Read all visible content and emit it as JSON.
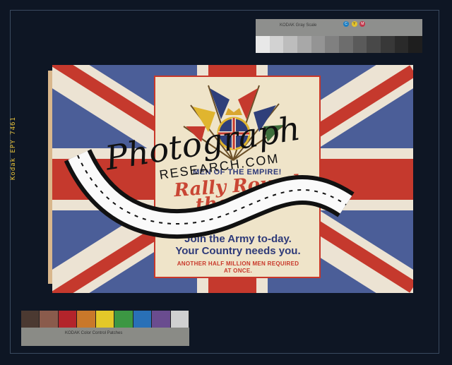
{
  "edge_code": "Kodak EPY 7461",
  "poster": {
    "header": "MEN OF THE EMPIRE!",
    "rally_line1": "Rally Round",
    "rally_line2": "the Flag",
    "join_line1": "Join the Army to-day.",
    "join_line2": "Your Country needs you.",
    "another_line1": "ANOTHER HALF MILLION MEN REQUIRED",
    "another_line2": "AT ONCE."
  },
  "gray_card": {
    "title": "KODAK Gray Scale",
    "dots": [
      "C",
      "Y",
      "M"
    ]
  },
  "color_card": {
    "title": "KODAK Color Control Patches"
  },
  "watermark": {
    "text": "Photograph",
    "sub": "RESEARCH.COM"
  },
  "colors": {
    "flag_blue": "#4b5e98",
    "flag_red": "#c5392d",
    "flag_white": "#ece3d3",
    "background": "#0e1624"
  }
}
